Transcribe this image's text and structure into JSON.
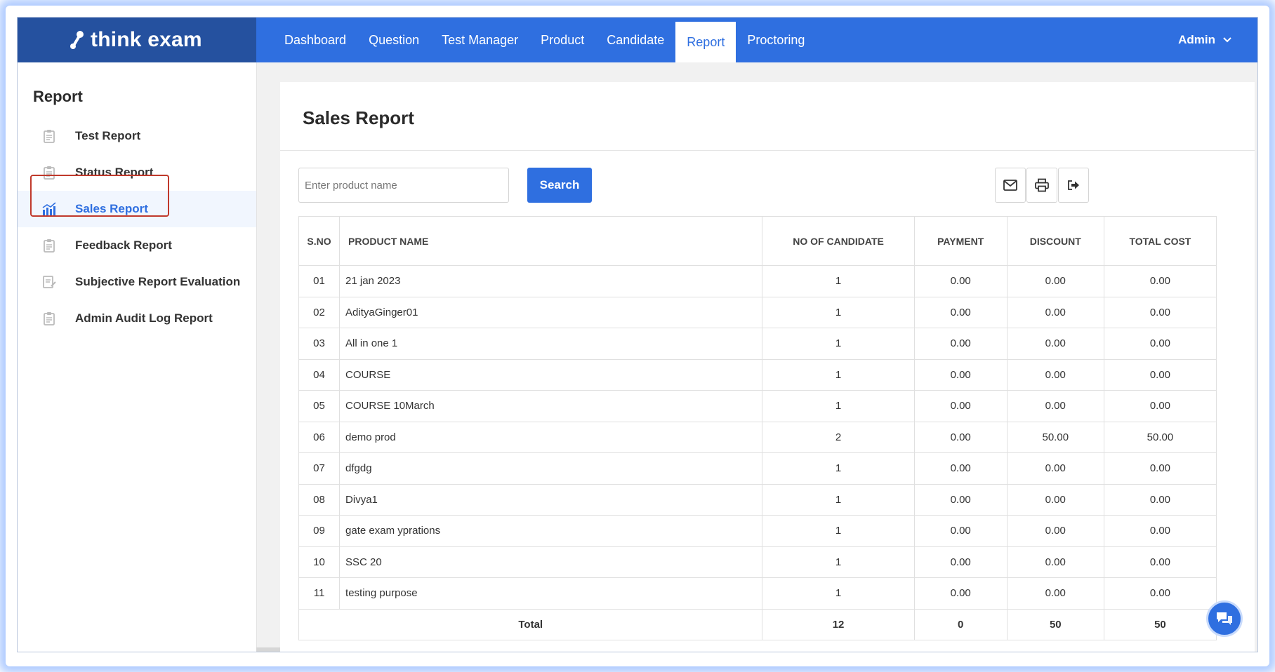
{
  "header": {
    "brand": "think exam",
    "nav": [
      {
        "label": "Dashboard",
        "active": false
      },
      {
        "label": "Question",
        "active": false
      },
      {
        "label": "Test Manager",
        "active": false
      },
      {
        "label": "Product",
        "active": false
      },
      {
        "label": "Candidate",
        "active": false
      },
      {
        "label": "Report",
        "active": true
      },
      {
        "label": "Proctoring",
        "active": false
      }
    ],
    "user": "Admin"
  },
  "sidebar": {
    "title": "Report",
    "items": [
      {
        "label": "Test Report",
        "icon": "clipboard-icon",
        "active": false
      },
      {
        "label": "Status Report",
        "icon": "clipboard-status-icon",
        "active": false
      },
      {
        "label": "Sales Report",
        "icon": "bar-chart-icon",
        "active": true
      },
      {
        "label": "Feedback Report",
        "icon": "clipboard-feedback-icon",
        "active": false
      },
      {
        "label": "Subjective Report Evaluation",
        "icon": "edit-document-icon",
        "active": false
      },
      {
        "label": "Admin Audit Log Report",
        "icon": "clipboard-log-icon",
        "active": false
      }
    ]
  },
  "main": {
    "title": "Sales Report",
    "search": {
      "placeholder": "Enter product name",
      "value": "",
      "button": "Search"
    },
    "tools": [
      "envelope-icon",
      "printer-icon",
      "export-icon"
    ],
    "table": {
      "columns": [
        "S.NO",
        "PRODUCT NAME",
        "NO OF CANDIDATE",
        "PAYMENT",
        "DISCOUNT",
        "TOTAL COST"
      ],
      "rows": [
        [
          "01",
          "21 jan 2023",
          "1",
          "0.00",
          "0.00",
          "0.00"
        ],
        [
          "02",
          "AdityaGinger01",
          "1",
          "0.00",
          "0.00",
          "0.00"
        ],
        [
          "03",
          "All in one 1",
          "1",
          "0.00",
          "0.00",
          "0.00"
        ],
        [
          "04",
          "COURSE",
          "1",
          "0.00",
          "0.00",
          "0.00"
        ],
        [
          "05",
          "COURSE 10March",
          "1",
          "0.00",
          "0.00",
          "0.00"
        ],
        [
          "06",
          "demo prod",
          "2",
          "0.00",
          "50.00",
          "50.00"
        ],
        [
          "07",
          "dfgdg",
          "1",
          "0.00",
          "0.00",
          "0.00"
        ],
        [
          "08",
          "Divya1",
          "1",
          "0.00",
          "0.00",
          "0.00"
        ],
        [
          "09",
          "gate exam yprations",
          "1",
          "0.00",
          "0.00",
          "0.00"
        ],
        [
          "10",
          "SSC 20",
          "1",
          "0.00",
          "0.00",
          "0.00"
        ],
        [
          "11",
          "testing purpose",
          "1",
          "0.00",
          "0.00",
          "0.00"
        ]
      ],
      "total": {
        "label": "Total",
        "candidates": "12",
        "payment": "0",
        "discount": "50",
        "total_cost": "50"
      }
    }
  },
  "colors": {
    "primary": "#2f6fe0",
    "brand_dark": "#25519f",
    "highlight_outline": "#c0392b"
  }
}
